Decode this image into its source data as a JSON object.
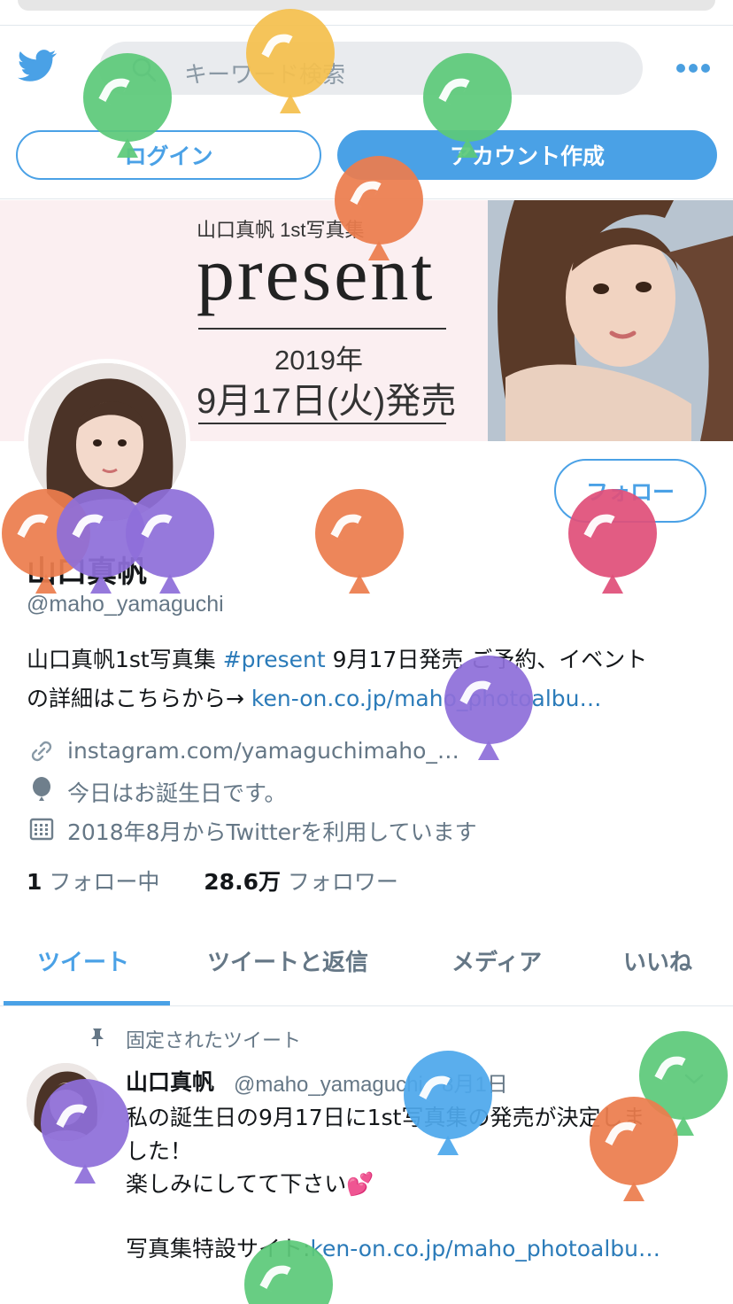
{
  "header": {
    "search_placeholder": "キーワード検索",
    "login_label": "ログイン",
    "signup_label": "アカウント作成"
  },
  "banner": {
    "subtitle": "山口真帆 1st写真集",
    "title": "present",
    "year": "2019年",
    "date": "9月17日(火)発売"
  },
  "profile": {
    "follow_label": "フォロー",
    "name": "山口真帆",
    "handle": "@maho_yamaguchi",
    "bio_line1_a": "山口真帆1st写真集 ",
    "bio_hashtag": "#present",
    "bio_line1_b": " 9月17日発売 ご予約、イベント",
    "bio_line2_a": "の詳細はこちらから→ ",
    "bio_link": "ken-on.co.jp/maho_photoalbu…",
    "website": "instagram.com/yamaguchimaho_…",
    "birthday": "今日はお誕生日です。",
    "joined": "2018年8月からTwitterを利用しています",
    "following_count": "1",
    "following_label": "フォロー中",
    "followers_count": "28.6万",
    "followers_label": "フォロワー"
  },
  "tabs": [
    {
      "label": "ツイート"
    },
    {
      "label": "ツイートと返信"
    },
    {
      "label": "メディア"
    },
    {
      "label": "いいね"
    }
  ],
  "pinned_tweet": {
    "pinned_label": "固定されたツイート",
    "name": "山口真帆",
    "handle_date": "@maho_yamaguchi · 8月1日",
    "line1": "私の誕生日の9月17日に1st写真集の発売が決定しま",
    "line2": "した！",
    "line3": "楽しみにしてて下さい💕",
    "line4_a": "写真集特設サイト:",
    "line4_link": "ken-on.co.jp/maho_photoalbu…"
  },
  "colors": {
    "accent": "#4aa1e6",
    "link": "#2b7bb9",
    "balloon_green": "#5cc97a",
    "balloon_yellow": "#f4c04e",
    "balloon_orange": "#ec7d4e",
    "balloon_purple": "#8e6fd9",
    "balloon_pink": "#e0507a",
    "balloon_blue": "#4ea8ec"
  },
  "icons": {
    "logo": "twitter-bird-icon",
    "search": "search-icon",
    "more": "more-dots-icon",
    "link": "link-icon",
    "birthday": "balloon-icon",
    "calendar": "calendar-icon",
    "pin": "pin-icon",
    "chevron": "chevron-down-icon"
  }
}
